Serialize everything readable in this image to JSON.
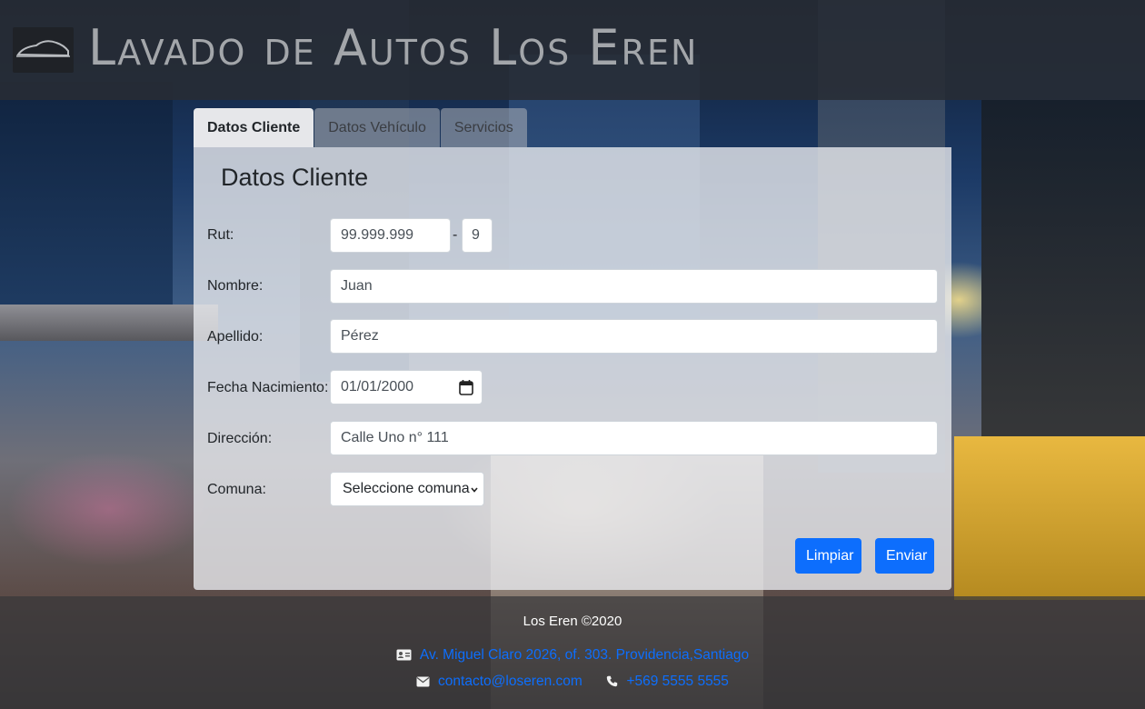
{
  "header": {
    "title": "Lavado de Autos Los Eren",
    "logo_icon": "car-logo-icon"
  },
  "tabs": [
    {
      "label": "Datos Cliente",
      "active": true
    },
    {
      "label": "Datos Vehículo",
      "active": false
    },
    {
      "label": "Servicios",
      "active": false
    }
  ],
  "form": {
    "title": "Datos Cliente",
    "rut": {
      "label": "Rut:",
      "number": "99.999.999",
      "separator": "-",
      "digit": "9"
    },
    "nombre": {
      "label": "Nombre:",
      "value": "Juan"
    },
    "apellido": {
      "label": "Apellido:",
      "value": "Pérez"
    },
    "fecha": {
      "label": "Fecha Nacimiento:",
      "value": "01/01/2000"
    },
    "direccion": {
      "label": "Dirección:",
      "value": "Calle Uno n° 111"
    },
    "comuna": {
      "label": "Comuna:",
      "selected": "Seleccione comuna"
    },
    "buttons": {
      "clear": "Limpiar",
      "submit": "Enviar"
    }
  },
  "footer": {
    "copyright": "Los Eren ©2020",
    "address": "Av. Miguel Claro 2026, of. 303. Providencia,Santiago",
    "email": "contacto@loseren.com",
    "phone": "+569 5555 5555"
  },
  "colors": {
    "primary": "#0d6efd",
    "header_bg": "#282c34",
    "title_text": "#a3a6aa"
  }
}
